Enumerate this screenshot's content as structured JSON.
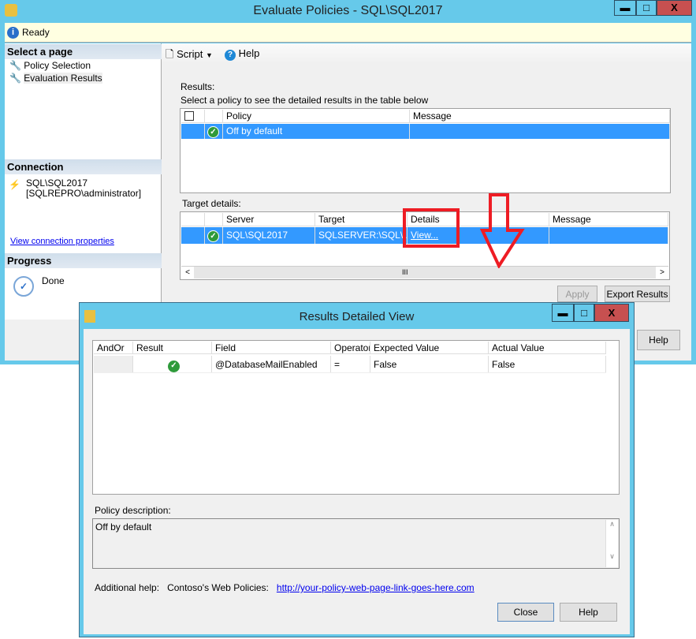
{
  "main_window": {
    "title": "Evaluate Policies - SQL\\SQL2017",
    "status": "Ready",
    "select_page_header": "Select a page",
    "pages": [
      {
        "label": "Policy Selection"
      },
      {
        "label": "Evaluation Results"
      }
    ],
    "connection_header": "Connection",
    "connection_server": "SQL\\SQL2017",
    "connection_user": "[SQLREPRO\\administrator]",
    "view_connection_link": "View connection properties",
    "progress_header": "Progress",
    "progress_status": "Done",
    "toolbar": {
      "script_label": "Script",
      "help_label": "Help"
    },
    "results_label": "Results:",
    "results_instruction": "Select a policy to see the detailed results in the table below",
    "results_table": {
      "columns": [
        "Policy",
        "Message"
      ],
      "rows": [
        {
          "policy": "Off by default",
          "message": ""
        }
      ]
    },
    "target_label": "Target details:",
    "target_table": {
      "columns": [
        "Server",
        "Target",
        "Details",
        "Message"
      ],
      "rows": [
        {
          "server": "SQL\\SQL2017",
          "target": "SQLSERVER:\\SQL\\...",
          "details": "View...",
          "message": ""
        }
      ]
    },
    "apply_label": "Apply",
    "export_label": "Export Results",
    "help_button": "Help",
    "highlight_color": "#ee1c24"
  },
  "dialog": {
    "title": "Results Detailed View",
    "columns": [
      "AndOr",
      "Result",
      "Field",
      "Operator",
      "Expected Value",
      "Actual Value"
    ],
    "rows": [
      {
        "andor": "",
        "result": "pass",
        "field": "@DatabaseMailEnabled",
        "operator": "=",
        "expected": "False",
        "actual": "False"
      }
    ],
    "description_label": "Policy description:",
    "description": "Off by default",
    "additional_help_label": "Additional help:",
    "help_source": "Contoso's Web Policies:",
    "help_link": "http://your-policy-web-page-link-goes-here.com",
    "close_label": "Close",
    "help_label": "Help"
  }
}
